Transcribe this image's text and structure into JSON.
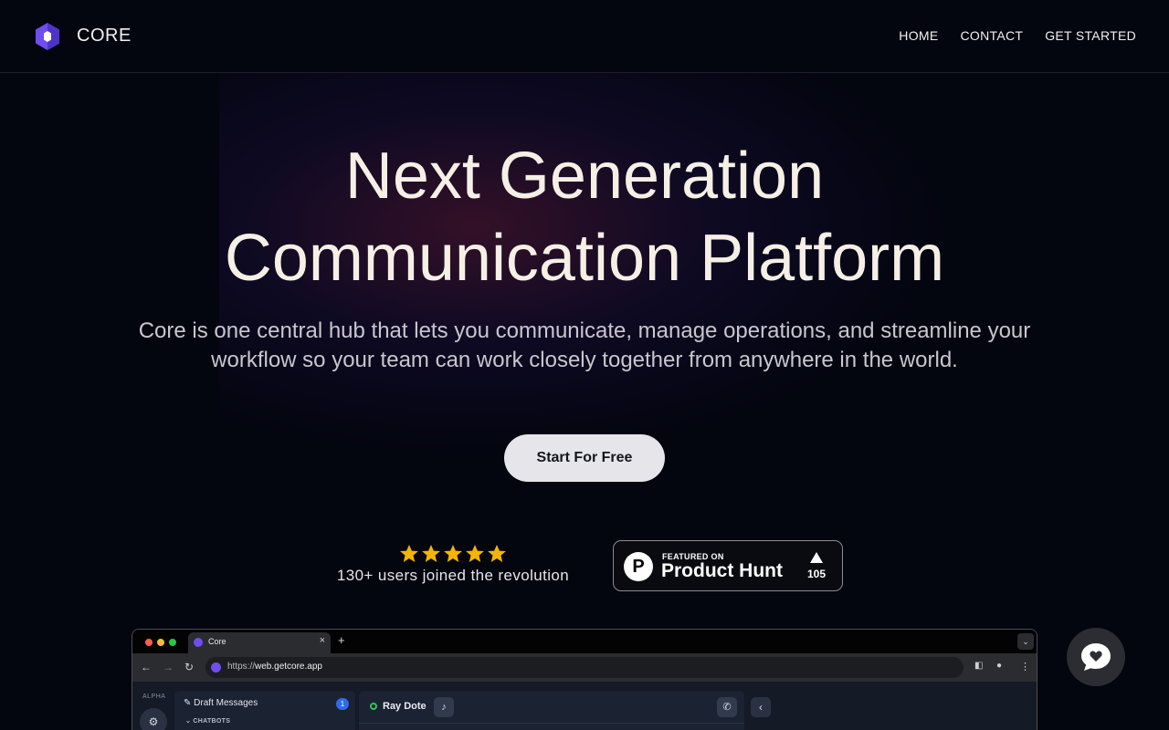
{
  "brand": {
    "name": "CORE",
    "logo_icon": "hexagon-logo-icon",
    "accent": "#6f4df0"
  },
  "nav": {
    "home": "HOME",
    "contact": "CONTACT",
    "get_started": "GET STARTED"
  },
  "hero": {
    "title_line1": "Next Generation",
    "title_line2": "Communication Platform",
    "subtitle_line1": "Core is one central hub that lets you communicate, manage operations, and streamline your",
    "subtitle_line2": "workflow so your team can work closely together from anywhere in the world.",
    "cta": "Start For Free"
  },
  "social_proof": {
    "rating": 5,
    "rating_max": 5,
    "star_color": "#f4b400",
    "joined_text": "130+ users joined the revolution"
  },
  "product_hunt": {
    "featured_on": "FEATURED ON",
    "name": "Product Hunt",
    "letter": "P",
    "upvotes": "105"
  },
  "browser_mock": {
    "tab_title": "Core",
    "tab_close": "×",
    "new_tab": "+",
    "url_scheme": "https://",
    "url_host": "web.getcore.app",
    "app": {
      "rail_label": "ALPHA",
      "draft_messages": "Draft Messages",
      "draft_count": "1",
      "chatbots_label": "CHATBOTS",
      "contact_name": "Ray Dote",
      "status_color": "#34c25a"
    }
  },
  "chat_widget": {
    "icon": "heart-chat-icon"
  }
}
